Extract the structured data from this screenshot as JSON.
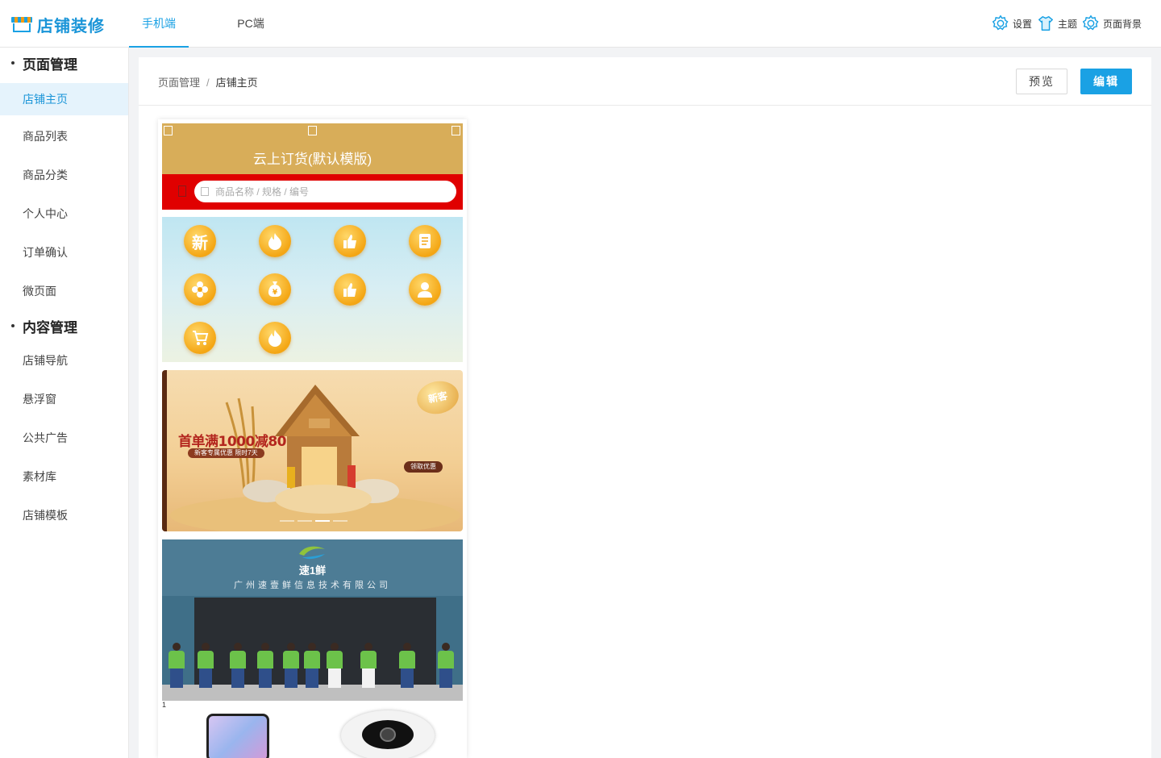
{
  "app": {
    "logo_text": "店铺装修"
  },
  "top_tabs": [
    {
      "label": "手机端",
      "active": true
    },
    {
      "label": "PC端",
      "active": false
    }
  ],
  "top_tools": [
    {
      "label": "设置",
      "icon": "gear-icon"
    },
    {
      "label": "主题",
      "icon": "tshirt-icon"
    },
    {
      "label": "页面背景",
      "icon": "gear-icon"
    }
  ],
  "sidebar": {
    "groups": [
      {
        "title": "页面管理",
        "items": [
          {
            "label": "店铺主页",
            "active": true
          },
          {
            "label": "商品列表"
          },
          {
            "label": "商品分类"
          },
          {
            "label": "个人中心"
          },
          {
            "label": "订单确认"
          },
          {
            "label": "微页面"
          }
        ]
      },
      {
        "title": "内容管理",
        "items": [
          {
            "label": "店铺导航"
          },
          {
            "label": "悬浮窗"
          },
          {
            "label": "公共广告"
          },
          {
            "label": "素材库"
          },
          {
            "label": "店铺模板"
          }
        ]
      }
    ]
  },
  "breadcrumb": {
    "parent": "页面管理",
    "separator": "/",
    "current": "店铺主页"
  },
  "actions": {
    "preview": "预览",
    "edit": "编辑"
  },
  "preview": {
    "title": "云上订货(默认模版)",
    "search_placeholder": "商品名称 / 规格 / 编号",
    "nav_icons": [
      "new-icon",
      "fire-icon",
      "thumbs-up-icon",
      "document-icon",
      "flower-icon",
      "money-bag-icon",
      "thumbs-up-icon",
      "user-icon",
      "cart-icon",
      "fire-icon"
    ],
    "new_glyph": "新",
    "banner": {
      "headline": "首单满1000减80",
      "subline": "新客专属优惠 限时7天",
      "badge": "新客",
      "cta": "领取优惠"
    },
    "company": {
      "brand": "速1鲜",
      "name": "广州速壹鲜信息技术有限公司"
    },
    "slide_indicator": "1"
  },
  "colors": {
    "accent": "#1aa1e4",
    "header_gold": "#d8ad59",
    "search_red": "#e00000",
    "icon_orange": "#f4a614"
  }
}
